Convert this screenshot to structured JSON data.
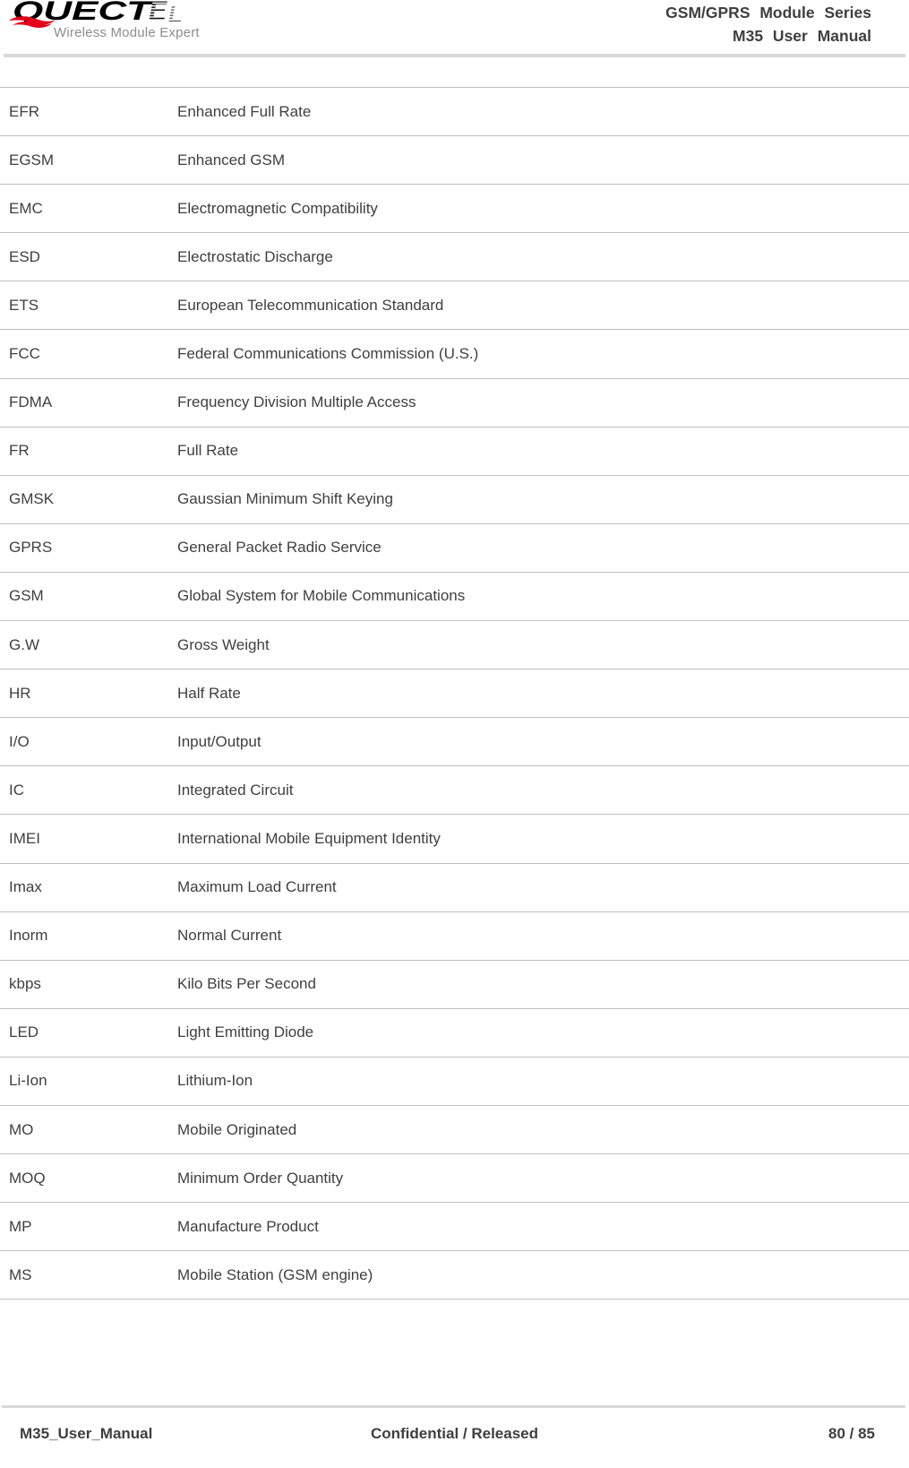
{
  "header": {
    "logo": {
      "wordmark": "QUECTEL",
      "tagline": "Wireless Module Expert",
      "swoosh_color": "#e2001a",
      "wordmark_color": "#000000",
      "tagline_color": "#8d8d8d"
    },
    "title_line1": "GSM/GPRS  Module  Series",
    "title_line2": "M35  User  Manual",
    "rule_color": "#d9d9d9"
  },
  "table": {
    "border_color": "#bfbfbf",
    "rows": [
      {
        "term": "EFR",
        "description": "Enhanced Full Rate"
      },
      {
        "term": "EGSM",
        "description": "Enhanced GSM"
      },
      {
        "term": "EMC",
        "description": "Electromagnetic Compatibility"
      },
      {
        "term": "ESD",
        "description": "Electrostatic Discharge"
      },
      {
        "term": "ETS",
        "description": "European Telecommunication Standard"
      },
      {
        "term": "FCC",
        "description": "Federal Communications Commission (U.S.)"
      },
      {
        "term": "FDMA",
        "description": "Frequency Division Multiple Access"
      },
      {
        "term": "FR",
        "description": "Full Rate"
      },
      {
        "term": "GMSK",
        "description": "Gaussian Minimum Shift Keying"
      },
      {
        "term": "GPRS",
        "description": "General Packet Radio Service"
      },
      {
        "term": "GSM",
        "description": "Global System for Mobile Communications"
      },
      {
        "term": "G.W",
        "description": "Gross Weight"
      },
      {
        "term": "HR",
        "description": "Half Rate"
      },
      {
        "term": "I/O",
        "description": "Input/Output"
      },
      {
        "term": "IC",
        "description": "Integrated Circuit"
      },
      {
        "term": "IMEI",
        "description": "International Mobile Equipment Identity"
      },
      {
        "term": "Imax",
        "description": "Maximum Load Current"
      },
      {
        "term": "Inorm",
        "description": "Normal Current"
      },
      {
        "term": "kbps",
        "description": "Kilo Bits Per Second"
      },
      {
        "term": "LED",
        "description": "Light Emitting Diode"
      },
      {
        "term": "Li-Ion",
        "description": "Lithium-Ion"
      },
      {
        "term": "MO",
        "description": "Mobile Originated"
      },
      {
        "term": "MOQ",
        "description": "Minimum Order Quantity"
      },
      {
        "term": "MP",
        "description": "Manufacture Product"
      },
      {
        "term": "MS",
        "description": "Mobile Station (GSM engine)"
      }
    ]
  },
  "footer": {
    "document_name": "M35_User_Manual",
    "classification": "Confidential / Released",
    "page_number": "80 / 85",
    "rule_color": "#d9d9d9"
  }
}
